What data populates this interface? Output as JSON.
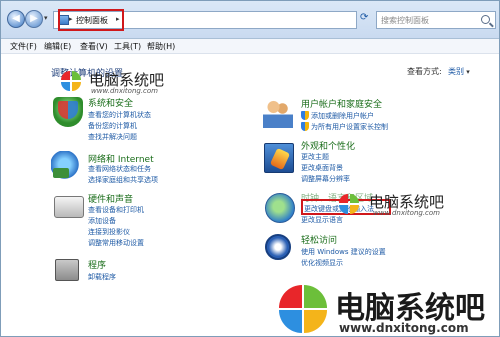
{
  "nav": {
    "address_crumb": "控制面板",
    "address_separator": "▸",
    "search_placeholder": "搜索控制面板"
  },
  "menu": [
    "文件(F)",
    "编辑(E)",
    "查看(V)",
    "工具(T)",
    "帮助(H)"
  ],
  "main": {
    "heading": "调整计算机的设置",
    "view_label": "查看方式:",
    "view_value": "类别"
  },
  "categories": {
    "system": {
      "title": "系统和安全",
      "links": [
        "查看您的计算机状态",
        "备份您的计算机",
        "查找并解决问题"
      ]
    },
    "network": {
      "title": "网络和 Internet",
      "links": [
        "查看网络状态和任务",
        "选择家庭组和共享选项"
      ]
    },
    "hardware": {
      "title": "硬件和声音",
      "links": [
        "查看设备和打印机",
        "添加设备",
        "连接到投影仪",
        "调整常用移动设置"
      ]
    },
    "programs": {
      "title": "程序",
      "links": [
        "卸载程序"
      ]
    },
    "users": {
      "title": "用户帐户和家庭安全",
      "links": [
        "添加或删除用户帐户",
        "为所有用户设置家长控制"
      ]
    },
    "appearance": {
      "title": "外观和个性化",
      "links": [
        "更改主题",
        "更改桌面背景",
        "调整屏幕分辨率"
      ]
    },
    "clock": {
      "title": "时钟、语言和区域",
      "links": [
        "更改键盘或其他输入法",
        "更改显示语言"
      ]
    },
    "access": {
      "title": "轻松访问",
      "links": [
        "使用 Windows 建议的设置",
        "优化视频显示"
      ]
    }
  },
  "watermark": {
    "brand": "电脑系统吧",
    "url": "www.dnxitong.com",
    "colors": {
      "red": "#e8262a",
      "green": "#6cbf3a",
      "blue": "#2d8fe0",
      "yellow": "#f4b41a"
    }
  },
  "colors": {
    "link": "#1e5aa5",
    "category_title": "#1a6d1a",
    "highlight_box": "#d0181b"
  }
}
